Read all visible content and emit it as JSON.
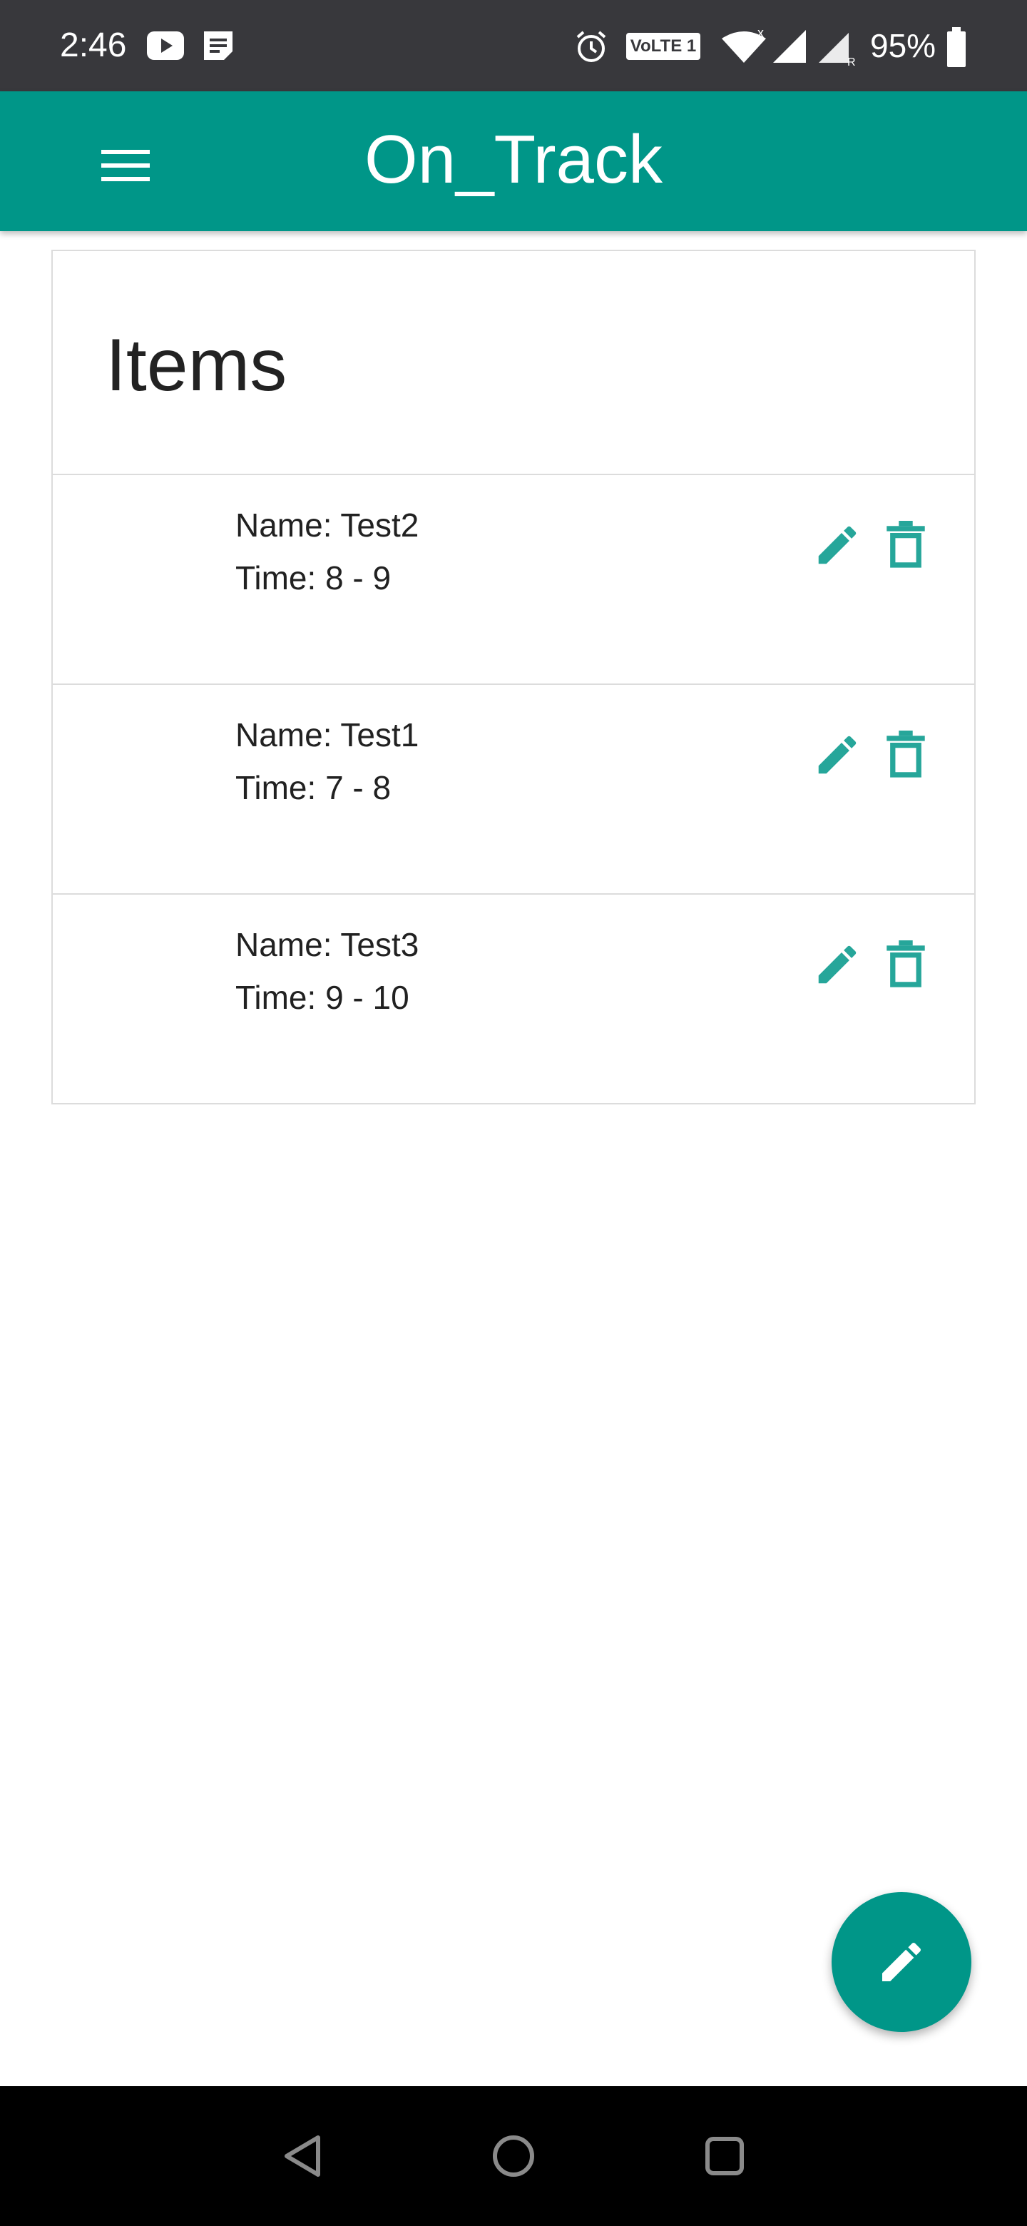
{
  "status_bar": {
    "time": "2:46",
    "network_badge": "VoLTE 1",
    "battery": "95%",
    "icons": [
      "youtube-icon",
      "notes-icon",
      "alarm-icon",
      "wifi-icon",
      "signal-icon",
      "signal-roaming-icon",
      "battery-icon"
    ]
  },
  "app_bar": {
    "title": "On_Track",
    "menu_icon": "hamburger-menu-icon"
  },
  "card": {
    "title": "Items",
    "items": [
      {
        "name": "Name: Test2",
        "time": "Time: 8 - 9"
      },
      {
        "name": "Name: Test1",
        "time": "Time: 7 - 8"
      },
      {
        "name": "Name: Test3",
        "time": "Time: 9 - 10"
      }
    ]
  },
  "fab": {
    "icon": "pencil-icon"
  },
  "colors": {
    "primary": "#009688",
    "status_bar": "#38383c",
    "nav_bar": "#000000"
  }
}
